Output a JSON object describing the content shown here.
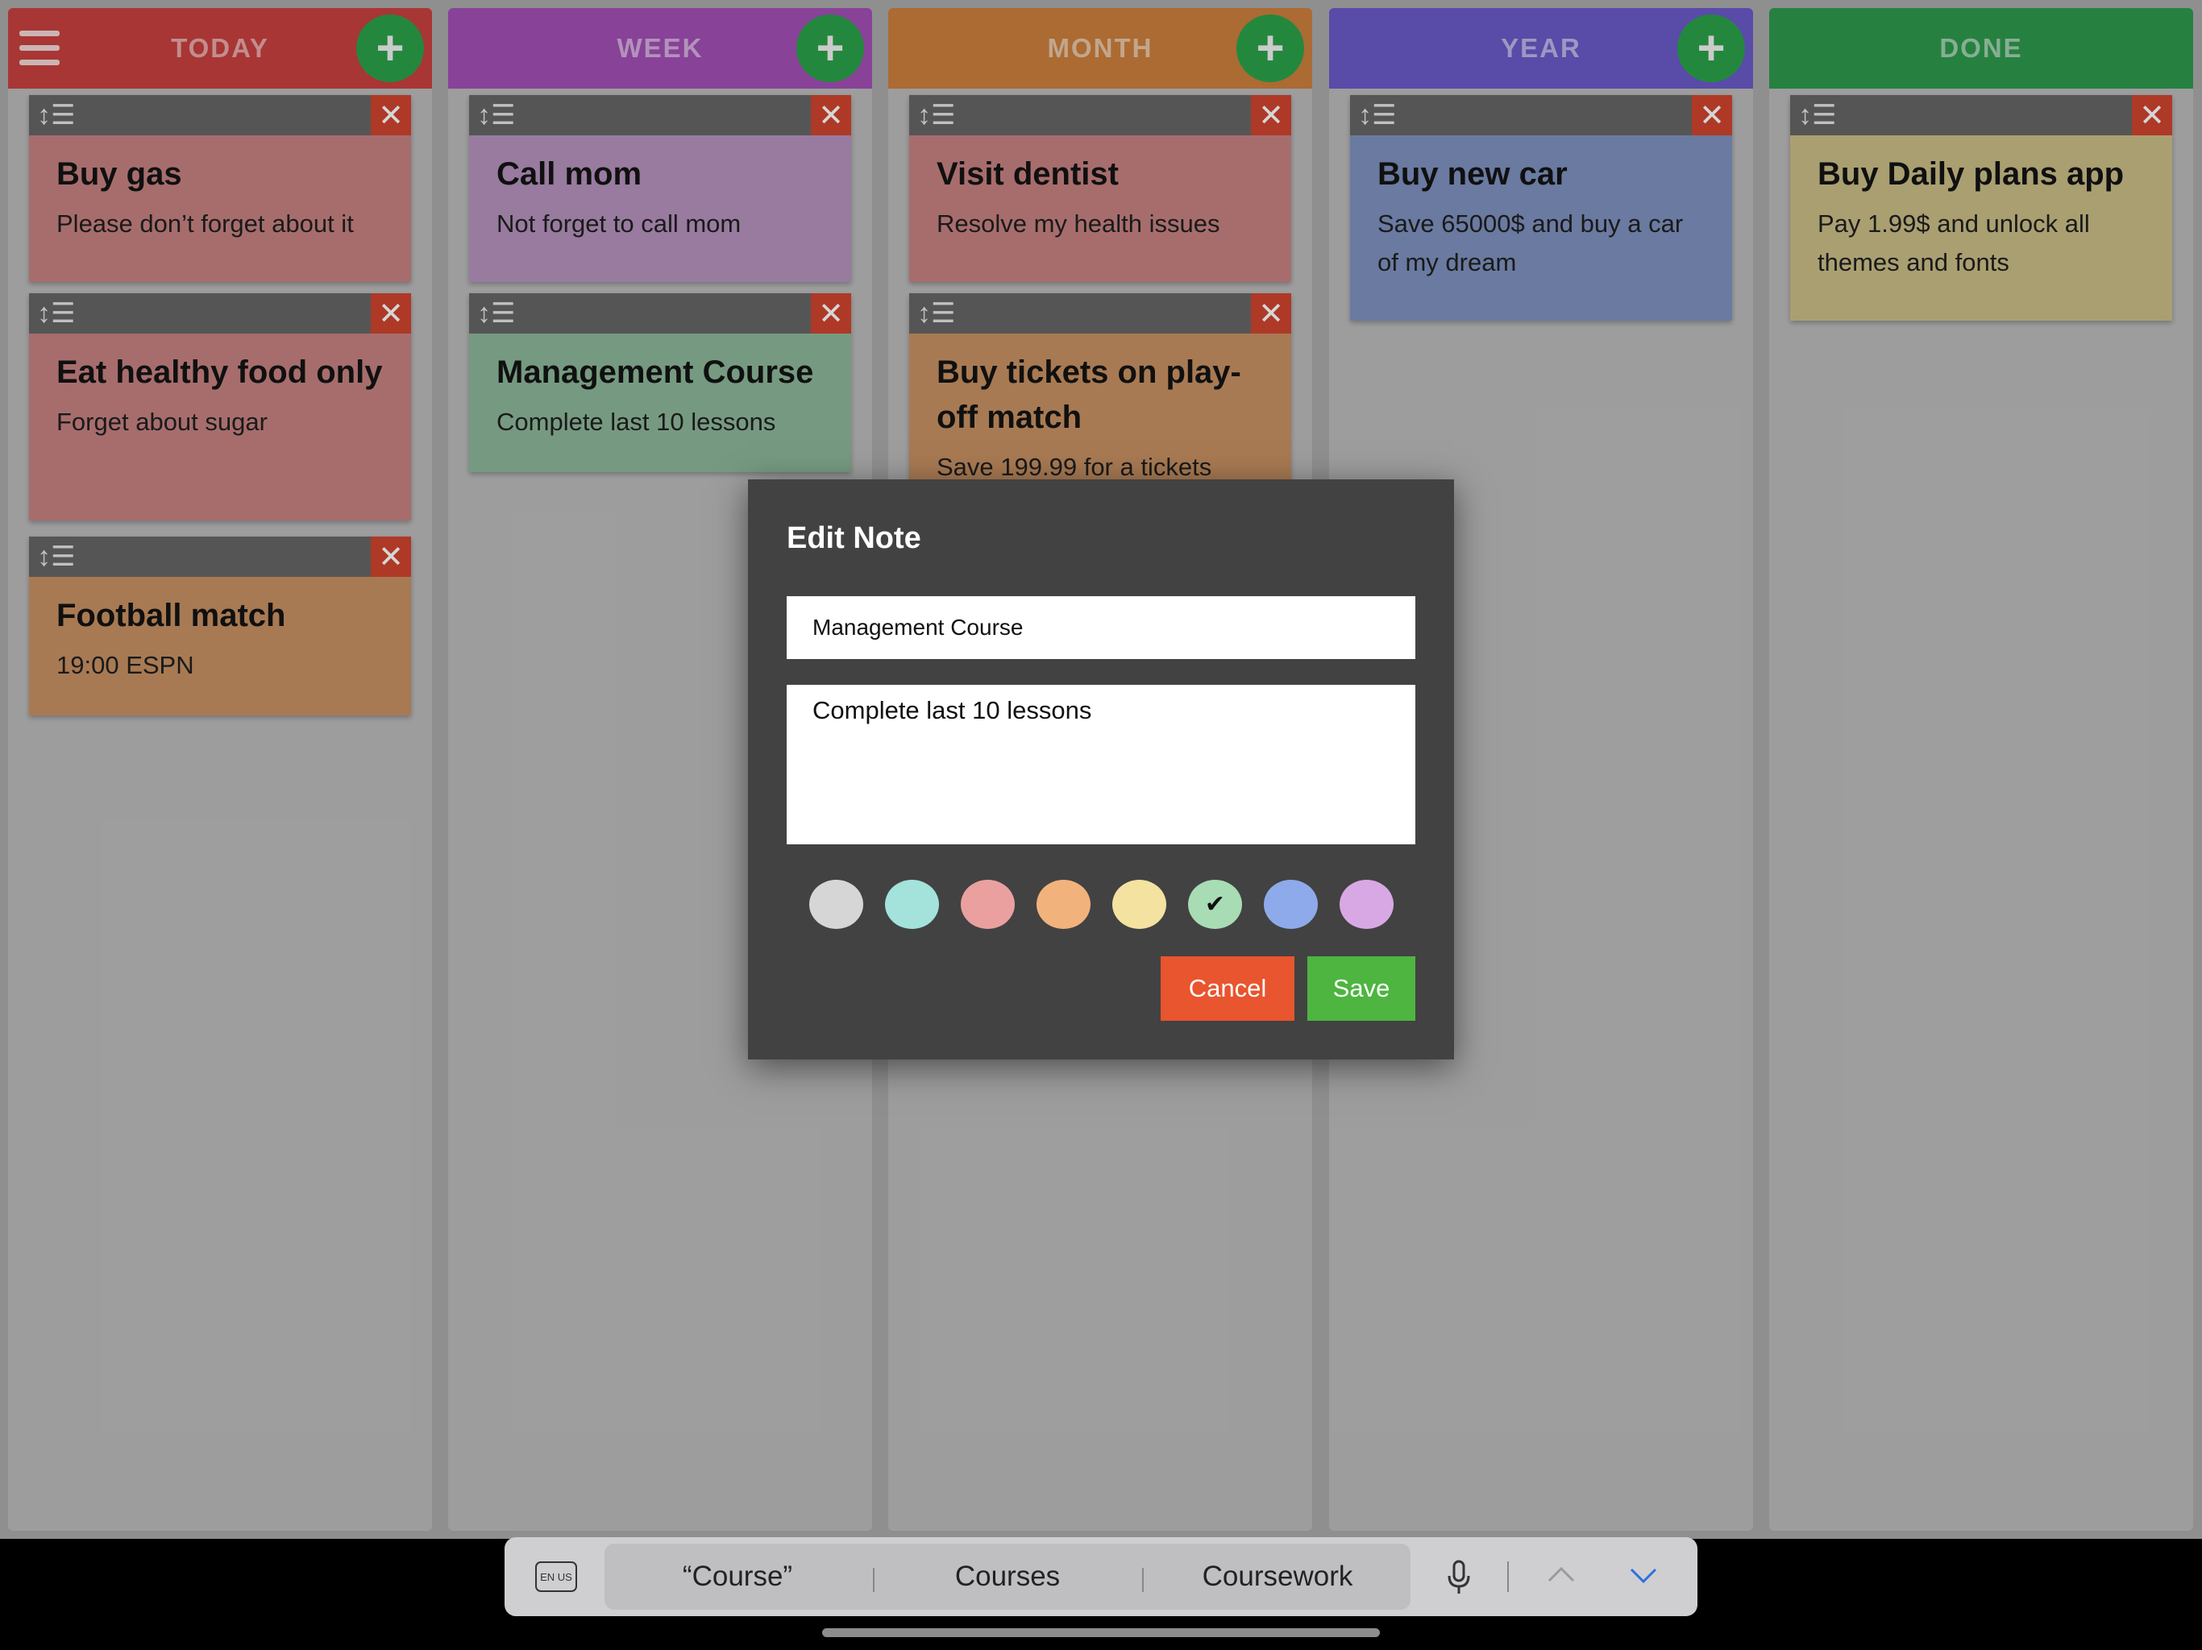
{
  "columns": [
    {
      "title": "TODAY",
      "color": "#c9413f",
      "has_add": true,
      "has_menu": true,
      "cards": [
        {
          "title": "Buy gas",
          "text": "Please don’t forget about it",
          "color": "#c88282"
        },
        {
          "title": "Eat healthy food only",
          "text": "Forget about sugar",
          "color": "#c88282"
        },
        {
          "title": "Football match",
          "text": "19:00 ESPN",
          "color": "#c99264"
        }
      ]
    },
    {
      "title": "WEEK",
      "color": "#a34fb5",
      "has_add": true,
      "cards": [
        {
          "title": "Call mom",
          "text": "Not forget to call mom",
          "color": "#b593be"
        },
        {
          "title": "Management Course",
          "text": "Complete last 10 lessons",
          "color": "#8db89a"
        }
      ]
    },
    {
      "title": "MONTH",
      "color": "#cc803d",
      "has_add": true,
      "cards": [
        {
          "title": "Visit dentist",
          "text": "Resolve my health issues",
          "color": "#c88282"
        },
        {
          "title": "Buy tickets on play-off match",
          "text": "Save 199.99 for a tickets",
          "color": "#c99264"
        }
      ]
    },
    {
      "title": "YEAR",
      "color": "#6a5ac9",
      "has_add": true,
      "cards": [
        {
          "title": "Buy new car",
          "text": "Save 65000$ and buy a car of my dream",
          "color": "#7f92bf"
        }
      ]
    },
    {
      "title": "DONE",
      "color": "#2e9a4e",
      "has_add": false,
      "cards": [
        {
          "title": "Buy Daily plans app",
          "text": "Pay 1.99$ and unlock all themes and fonts",
          "color": "#cbbe87"
        }
      ]
    }
  ],
  "dialog": {
    "title": "Edit Note",
    "note_title": "Management Course",
    "note_text": "Complete last 10 lessons",
    "swatches": [
      "#d6d6d6",
      "#a4e2dc",
      "#eba0a0",
      "#f2b27c",
      "#f4e2a0",
      "#a8dcb4",
      "#8eaaea",
      "#d8a8e4"
    ],
    "selected_swatch": 5,
    "cancel_label": "Cancel",
    "save_label": "Save",
    "cancel_color": "#e8552e",
    "save_color": "#4db540"
  },
  "keyboard": {
    "keyboard_icon_label": "EN US",
    "suggestions": [
      "“Course”",
      "Courses",
      "Coursework"
    ]
  }
}
